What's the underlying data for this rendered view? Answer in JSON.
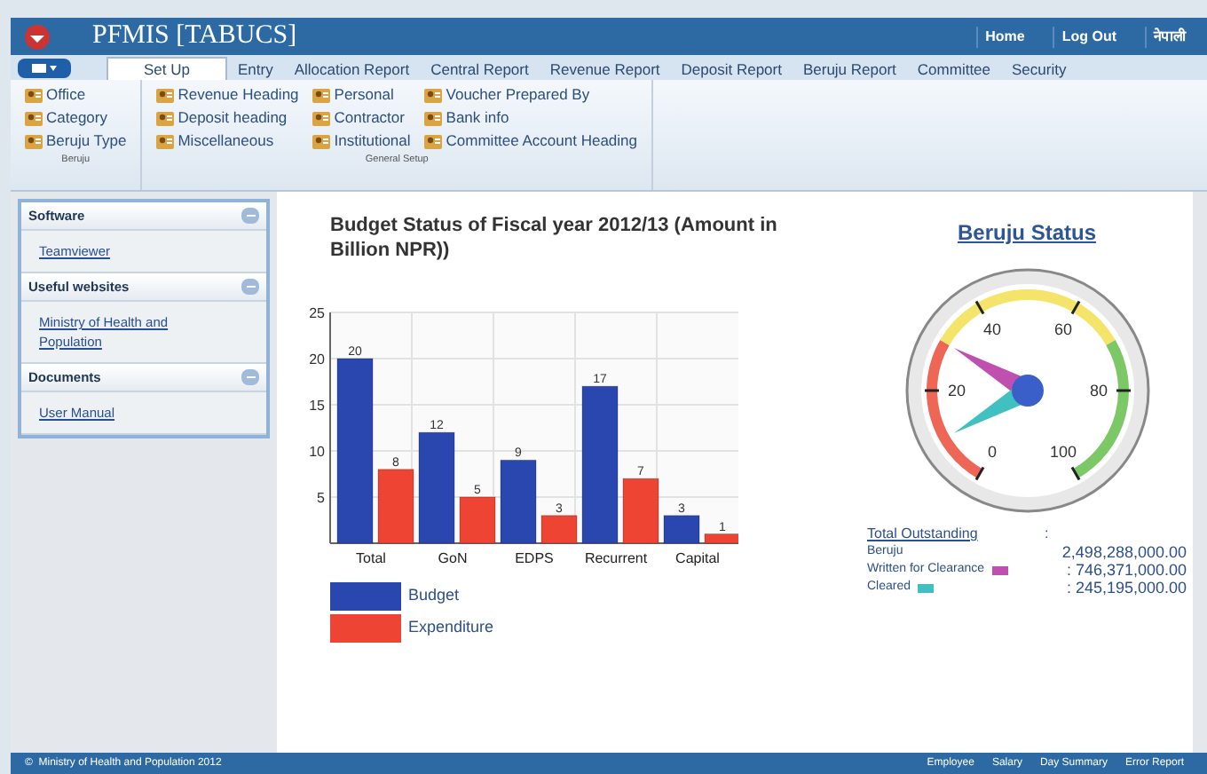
{
  "header": {
    "title": "PFMIS [TABUCS]",
    "links": [
      "Home",
      "Log Out",
      "नेपाली"
    ]
  },
  "tabs": [
    {
      "label": "Set Up",
      "selected": true
    },
    {
      "label": "Entry",
      "selected": false
    },
    {
      "label": "Allocation Report",
      "selected": false
    },
    {
      "label": "Central Report",
      "selected": false
    },
    {
      "label": "Revenue Report",
      "selected": false
    },
    {
      "label": "Deposit Report",
      "selected": false
    },
    {
      "label": "Beruju Report",
      "selected": false
    },
    {
      "label": "Committee",
      "selected": false
    },
    {
      "label": "Security",
      "selected": false
    }
  ],
  "ribbon": [
    {
      "label": "Beruju",
      "columns": [
        [
          "Office",
          "Category",
          "Beruju Type"
        ]
      ]
    },
    {
      "label": "General Setup",
      "columns": [
        [
          "Revenue Heading",
          "Deposit heading",
          "Miscellaneous"
        ],
        [
          "Personal",
          "Contractor",
          "Institutional"
        ],
        [
          "Voucher Prepared By",
          "Bank info",
          "Committee Account Heading"
        ]
      ]
    }
  ],
  "sidebar": [
    {
      "title": "Software",
      "expanded": true,
      "links": [
        "Teamviewer"
      ]
    },
    {
      "title": "Useful websites",
      "expanded": true,
      "links": [
        "Ministry of Health and Population"
      ]
    },
    {
      "title": "Documents",
      "expanded": true,
      "links": [
        "User Manual"
      ]
    }
  ],
  "budget": {
    "chart_data": {
      "type": "bar",
      "title": "Budget Status of Fiscal year 2012/13 (Amount in Billion NPR))",
      "categories": [
        "Total",
        "GoN",
        "EDPS",
        "Recurrent",
        "Capital"
      ],
      "series": [
        {
          "name": "Budget",
          "color": "#2a47b0",
          "values": [
            20,
            12,
            9,
            17,
            3
          ]
        },
        {
          "name": "Expenditure",
          "color": "#ee4433",
          "values": [
            8,
            5,
            3,
            7,
            1
          ]
        }
      ],
      "ylim": [
        0,
        25
      ],
      "yticks": [
        5,
        10,
        15,
        20,
        25
      ],
      "grid": true,
      "data_labels": true
    }
  },
  "beruju": {
    "title": "Beruju Status",
    "ticks": [
      "0",
      "20",
      "40",
      "60",
      "80",
      "100"
    ],
    "summary_heading": "Total Outstanding",
    "summary_colon": ":",
    "rows": [
      {
        "label": "Beruju",
        "value": "2,498,288,000.00"
      },
      {
        "label": "Written for Clearance",
        "color": "#c050b0",
        "value": ": 746,371,000.00"
      },
      {
        "label": "Cleared",
        "color": "#40c0c0",
        "value": ": 245,195,000.00"
      }
    ]
  },
  "footer": {
    "copyright": "©  Ministry of Health and Population 2012",
    "links": [
      "Employee",
      "Salary",
      "Day Summary",
      "Error Report"
    ]
  }
}
